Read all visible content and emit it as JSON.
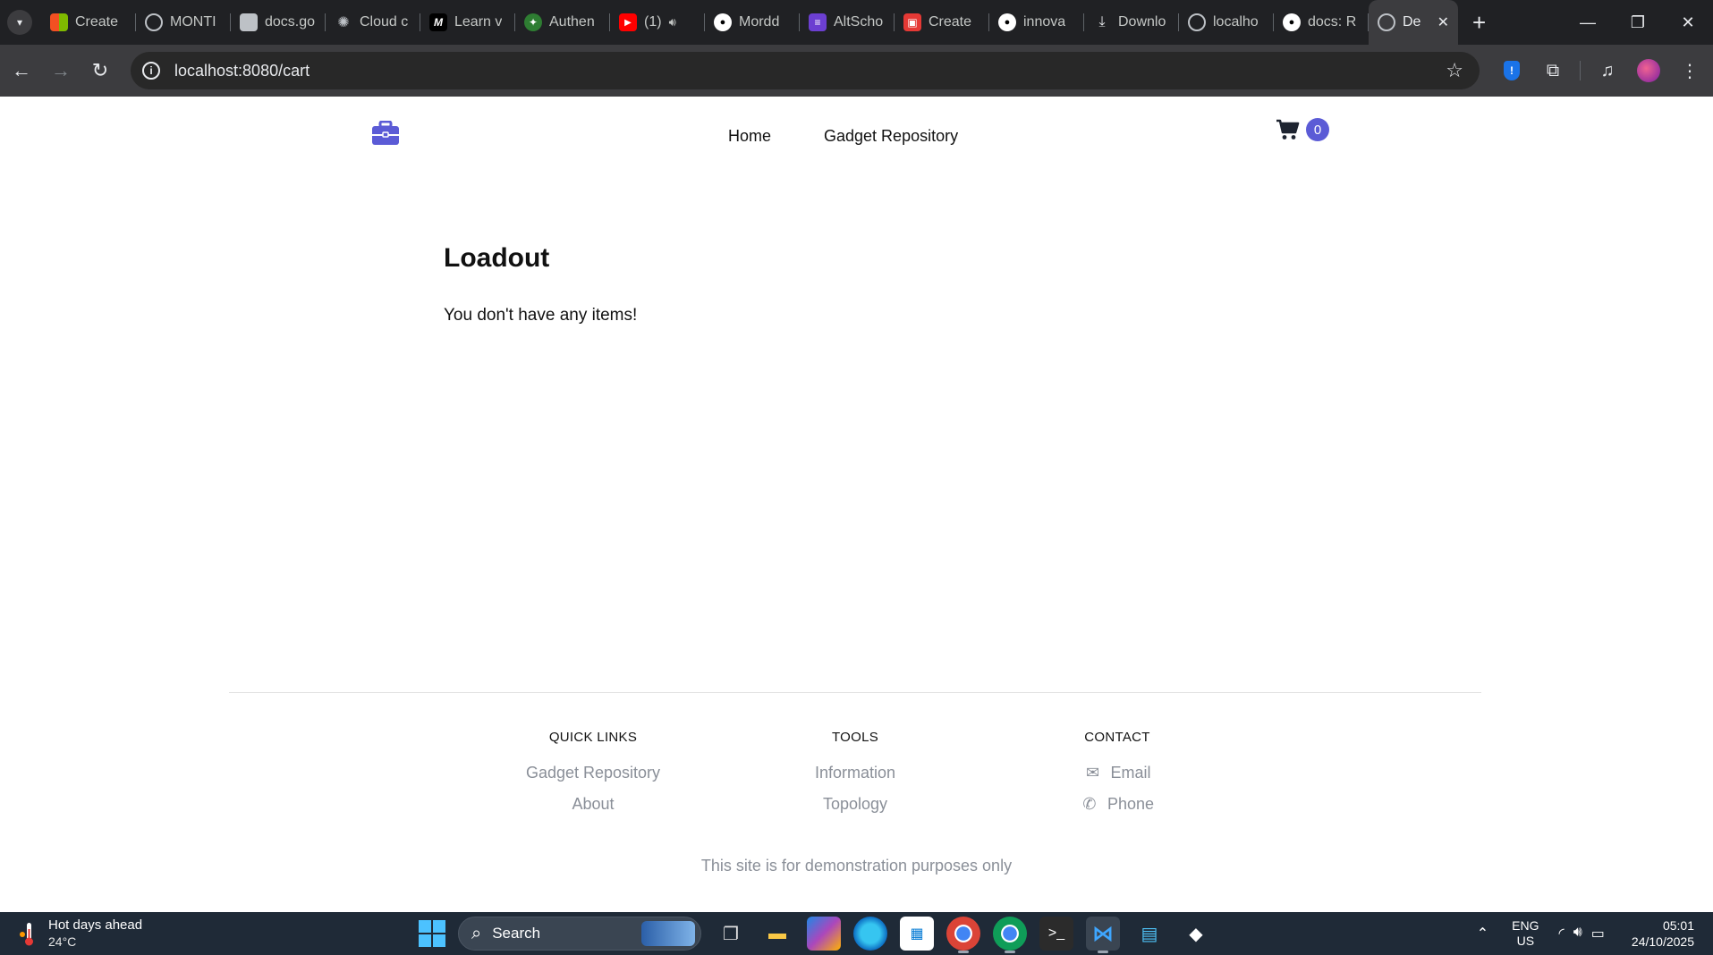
{
  "browser": {
    "tabs": [
      {
        "label": "Create",
        "icon": "microsoft-icon",
        "color": "#f25022"
      },
      {
        "label": "MONTI",
        "icon": "globe-icon",
        "color": "#9aa0a6"
      },
      {
        "label": "docs.go",
        "icon": "doc-icon",
        "color": "#bdc1c6"
      },
      {
        "label": "Cloud c",
        "icon": "openai-icon",
        "color": "#bdc1c6"
      },
      {
        "label": "Learn v",
        "icon": "m-logo-icon",
        "color": "#000000"
      },
      {
        "label": "Authen",
        "icon": "crest-icon",
        "color": "#2e7d32"
      },
      {
        "label": "(1)",
        "icon": "youtube-icon",
        "color": "#ff0000"
      },
      {
        "label": "Mordd",
        "icon": "github-icon",
        "color": "#ffffff"
      },
      {
        "label": "AltScho",
        "icon": "altschool-icon",
        "color": "#6c3fd1"
      },
      {
        "label": "Create",
        "icon": "app-icon",
        "color": "#e53935"
      },
      {
        "label": "innova",
        "icon": "github-icon",
        "color": "#ffffff"
      },
      {
        "label": "Downlo",
        "icon": "download-icon",
        "color": "#e8eaed"
      },
      {
        "label": "localho",
        "icon": "globe-icon",
        "color": "#9aa0a6"
      },
      {
        "label": "docs: R",
        "icon": "github-icon",
        "color": "#ffffff"
      }
    ],
    "active_tab": {
      "label": "De",
      "icon": "globe-icon"
    },
    "url": "localhost:8080/cart"
  },
  "site": {
    "accent": "#5b5bd6",
    "nav": {
      "home": "Home",
      "repository": "Gadget Repository",
      "cart_count": "0"
    },
    "content": {
      "title": "Loadout",
      "message": "You don't have any items!"
    },
    "footer": {
      "quick_links": {
        "heading": "QUICK LINKS",
        "items": [
          "Gadget Repository",
          "About"
        ]
      },
      "tools": {
        "heading": "TOOLS",
        "items": [
          "Information",
          "Topology"
        ]
      },
      "contact": {
        "heading": "CONTACT",
        "items": [
          "Email",
          "Phone"
        ]
      },
      "disclaimer": "This site is for demonstration purposes only"
    }
  },
  "taskbar": {
    "weather": {
      "title": "Hot days ahead",
      "temp": "24°C"
    },
    "search_placeholder": "Search",
    "language": {
      "line1": "ENG",
      "line2": "US"
    },
    "clock": {
      "time": "05:01",
      "date": "24/10/2025"
    }
  }
}
